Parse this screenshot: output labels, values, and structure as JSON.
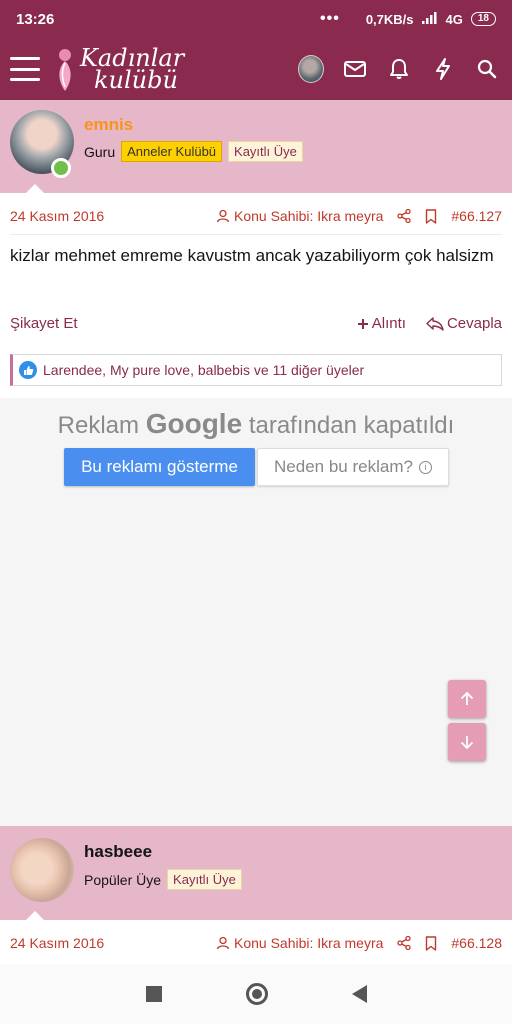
{
  "status": {
    "time": "13:26",
    "dots": "•••",
    "speed": "0,7KB/s",
    "network": "4G",
    "battery": "18"
  },
  "header": {
    "logo_line1": "Kadınlar",
    "logo_line2": "kulübü"
  },
  "posts": [
    {
      "username": "emnis",
      "username_color": "#f7941d",
      "title": "Guru",
      "badges": [
        "Anneler Kulübü",
        "Kayıtlı Üye"
      ],
      "date": "24 Kasım 2016",
      "author_label": "Konu Sahibi: Ikra meyra",
      "number": "#66.127",
      "message": "kizlar mehmet emreme kavustm ancak yazabiliyorm çok halsizm",
      "report_label": "Şikayet Et",
      "quote_label": "Alıntı",
      "reply_label": "Cevapla",
      "likes_text": "Larendee, My pure love, balbebis ve 11 diğer üyeler"
    },
    {
      "username": "hasbeee",
      "username_color": "#141414",
      "title": "Popüler Üye",
      "badges": [
        "Kayıtlı Üye"
      ],
      "date": "24 Kasım 2016",
      "author_label": "Konu Sahibi: Ikra meyra",
      "number": "#66.128"
    }
  ],
  "ad": {
    "title_prefix": "Reklam",
    "title_brand": "Google",
    "title_suffix": "tarafından kapatıldı",
    "hide_button": "Bu reklamı gösterme",
    "why_button": "Neden bu reklam?"
  },
  "colors": {
    "brand": "#8a2a4f",
    "post_header_bg": "#e6b7c8",
    "accent_red": "#c0392b",
    "scroll_button": "#e49db4"
  }
}
